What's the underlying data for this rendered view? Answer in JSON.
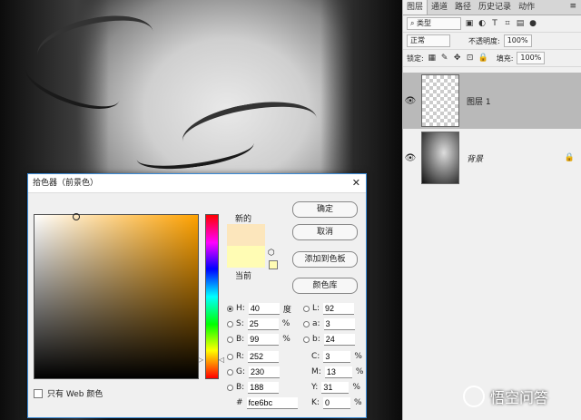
{
  "panel": {
    "tabs": [
      "图层",
      "通道",
      "路径",
      "历史记录",
      "动作"
    ],
    "filter_kind": "类型",
    "blend_mode": "正常",
    "opacity_label": "不透明度:",
    "opacity_value": "100%",
    "lock_label": "锁定:",
    "fill_label": "填充:",
    "fill_value": "100%",
    "layers": [
      {
        "name": "图层 1"
      },
      {
        "name": "背景"
      }
    ]
  },
  "dialog": {
    "title": "拾色器（前景色）",
    "new_label": "新的",
    "current_label": "当前",
    "new_color": "#fce6bc",
    "current_color": "#fffcb4",
    "buttons": {
      "ok": "确定",
      "cancel": "取消",
      "add_swatch": "添加到色板",
      "libraries": "颜色库"
    },
    "hsb": [
      {
        "key": "H:",
        "value": "40",
        "unit": "度"
      },
      {
        "key": "S:",
        "value": "25",
        "unit": "%"
      },
      {
        "key": "B:",
        "value": "99",
        "unit": "%"
      }
    ],
    "rgb": [
      {
        "key": "R:",
        "value": "252"
      },
      {
        "key": "G:",
        "value": "230"
      },
      {
        "key": "B:",
        "value": "188"
      }
    ],
    "lab": [
      {
        "key": "L:",
        "value": "92"
      },
      {
        "key": "a:",
        "value": "3"
      },
      {
        "key": "b:",
        "value": "24"
      }
    ],
    "cmyk": [
      {
        "key": "C:",
        "value": "3",
        "unit": "%"
      },
      {
        "key": "M:",
        "value": "13",
        "unit": "%"
      },
      {
        "key": "Y:",
        "value": "31",
        "unit": "%"
      },
      {
        "key": "K:",
        "value": "0",
        "unit": "%"
      }
    ],
    "hex_label": "#",
    "hex_value": "fce6bc",
    "web_only": "只有 Web 颜色"
  },
  "watermark": "悟空问答"
}
